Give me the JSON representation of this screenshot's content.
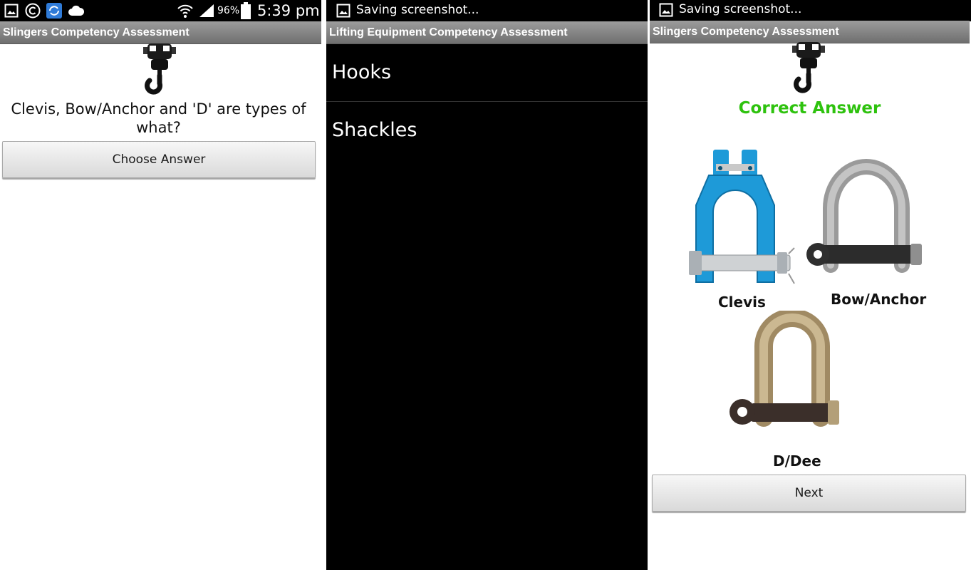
{
  "status_bar": {
    "battery": "96%",
    "time": "5:39 pm",
    "icons": [
      "gallery-icon",
      "copyright-icon",
      "sync-icon",
      "cloud-icon",
      "wifi-icon",
      "signal-icon",
      "battery-icon"
    ]
  },
  "screen1": {
    "title": "Slingers Competency Assessment",
    "question": "Clevis, Bow/Anchor and 'D' are types of what?",
    "choose_button": "Choose Answer"
  },
  "screen2": {
    "notification": "Saving screenshot...",
    "title": "Lifting Equipment Competency Assessment",
    "options": [
      "Hooks",
      "Shackles"
    ]
  },
  "screen3": {
    "notification": "Saving screenshot...",
    "title": "Slingers Competency Assessment",
    "result": "Correct Answer",
    "labels": {
      "clevis": "Clevis",
      "bow": "Bow/Anchor",
      "dee": "D/Dee"
    },
    "next_button": "Next"
  },
  "colors": {
    "correct": "#2ec20e",
    "clevis_blue": "#1e9ad8",
    "titlebar": "#8a8a8a"
  }
}
